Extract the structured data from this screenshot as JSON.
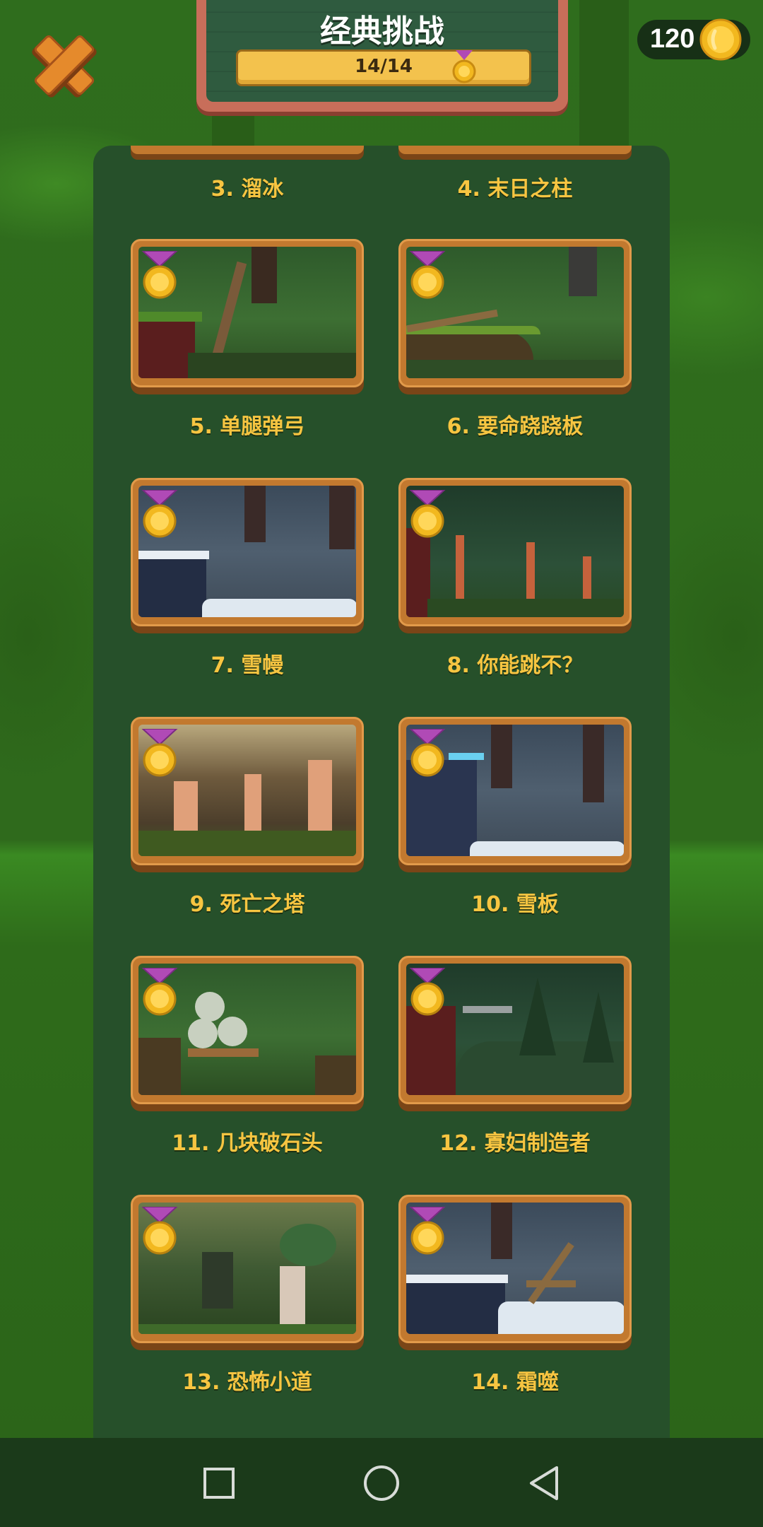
{
  "header": {
    "title": "经典挑战",
    "progress_text": "14/14",
    "coins": "120"
  },
  "partial_levels": [
    {
      "label": "3. 溜冰"
    },
    {
      "label": "4. 末日之柱"
    }
  ],
  "levels": [
    {
      "label": "5. 单腿弹弓",
      "theme": "forest",
      "completed": true
    },
    {
      "label": "6. 要命跷跷板",
      "theme": "forest",
      "completed": true
    },
    {
      "label": "7. 雪幔",
      "theme": "snow",
      "completed": true
    },
    {
      "label": "8. 你能跳不？",
      "theme": "deep",
      "completed": true
    },
    {
      "label": "9. 死亡之塔",
      "theme": "dusk",
      "completed": true
    },
    {
      "label": "10. 雪板",
      "theme": "snow",
      "completed": true
    },
    {
      "label": "11. 几块破石头",
      "theme": "forest",
      "completed": true
    },
    {
      "label": "12. 寡妇制造者",
      "theme": "deep",
      "completed": true
    },
    {
      "label": "13. 恐怖小道",
      "theme": "mist",
      "completed": true
    },
    {
      "label": "14. 霜噬",
      "theme": "snow",
      "completed": true
    }
  ],
  "colors": {
    "accent_gold": "#f7c541",
    "card_wood": "#c2792f",
    "panel": "#26502a",
    "medal_ribbon": "#b04ab6"
  },
  "icons": {
    "close": "close-icon",
    "coin": "coin-icon",
    "medal": "gold-medal-icon",
    "nav_recents": "square-icon",
    "nav_home": "circle-icon",
    "nav_back": "triangle-back-icon"
  }
}
